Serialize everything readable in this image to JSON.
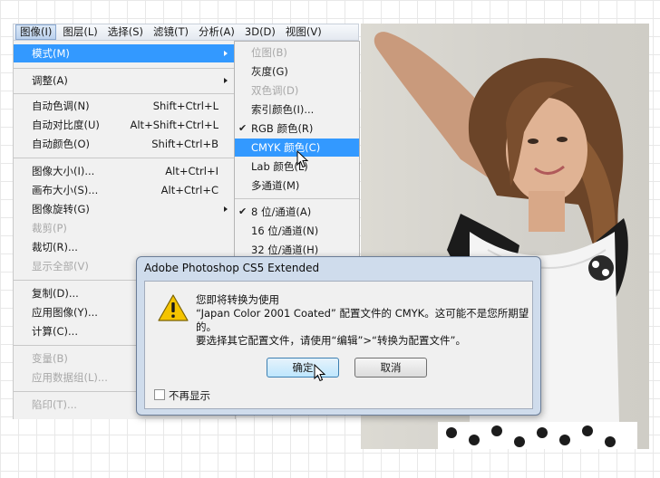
{
  "menubar": {
    "items": [
      {
        "label": "图像(I)",
        "active": true
      },
      {
        "label": "图层(L)"
      },
      {
        "label": "选择(S)"
      },
      {
        "label": "滤镜(T)"
      },
      {
        "label": "分析(A)"
      },
      {
        "label": "3D(D)"
      },
      {
        "label": "视图(V)"
      }
    ]
  },
  "image_menu": {
    "items": [
      {
        "label": "模式(M)",
        "submenu": true,
        "highlighted": true
      },
      {
        "label": "调整(A)",
        "submenu": true
      },
      {
        "label": "自动色调(N)",
        "shortcut": "Shift+Ctrl+L"
      },
      {
        "label": "自动对比度(U)",
        "shortcut": "Alt+Shift+Ctrl+L"
      },
      {
        "label": "自动颜色(O)",
        "shortcut": "Shift+Ctrl+B"
      },
      {
        "label": "图像大小(I)...",
        "shortcut": "Alt+Ctrl+I"
      },
      {
        "label": "画布大小(S)...",
        "shortcut": "Alt+Ctrl+C"
      },
      {
        "label": "图像旋转(G)",
        "submenu": true
      },
      {
        "label": "裁剪(P)",
        "disabled": true
      },
      {
        "label": "裁切(R)..."
      },
      {
        "label": "显示全部(V)",
        "disabled": true
      },
      {
        "label": "复制(D)..."
      },
      {
        "label": "应用图像(Y)..."
      },
      {
        "label": "计算(C)..."
      },
      {
        "label": "变量(B)",
        "disabled": true
      },
      {
        "label": "应用数据组(L)...",
        "disabled": true
      },
      {
        "label": "陷印(T)...",
        "disabled": true
      }
    ]
  },
  "mode_submenu": {
    "items": [
      {
        "label": "位图(B)",
        "disabled": true
      },
      {
        "label": "灰度(G)"
      },
      {
        "label": "双色调(D)",
        "disabled": true
      },
      {
        "label": "索引颜色(I)..."
      },
      {
        "label": "RGB 颜色(R)",
        "checked": true
      },
      {
        "label": "CMYK 颜色(C)",
        "highlighted": true
      },
      {
        "label": "Lab 颜色(L)"
      },
      {
        "label": "多通道(M)"
      },
      {
        "label": "8 位/通道(A)",
        "checked": true
      },
      {
        "label": "16 位/通道(N)"
      },
      {
        "label": "32 位/通道(H)"
      }
    ]
  },
  "dialog": {
    "title": "Adobe Photoshop CS5 Extended",
    "icon": "warning-icon",
    "message_lines": [
      "您即将转换为使用",
      "“Japan Color 2001 Coated” 配置文件的 CMYK。这可能不是您所期望",
      "的。",
      "要选择其它配置文件，请使用“编辑”>“转换为配置文件”。"
    ],
    "ok_label": "确定",
    "cancel_label": "取消",
    "dont_show_label": "不再显示",
    "dont_show_checked": false
  },
  "colors": {
    "highlight": "#3399ff",
    "menu_bg": "#f1f1f1",
    "dialog_frame": "#cfdcec",
    "disabled_text": "#a8a8a8"
  }
}
